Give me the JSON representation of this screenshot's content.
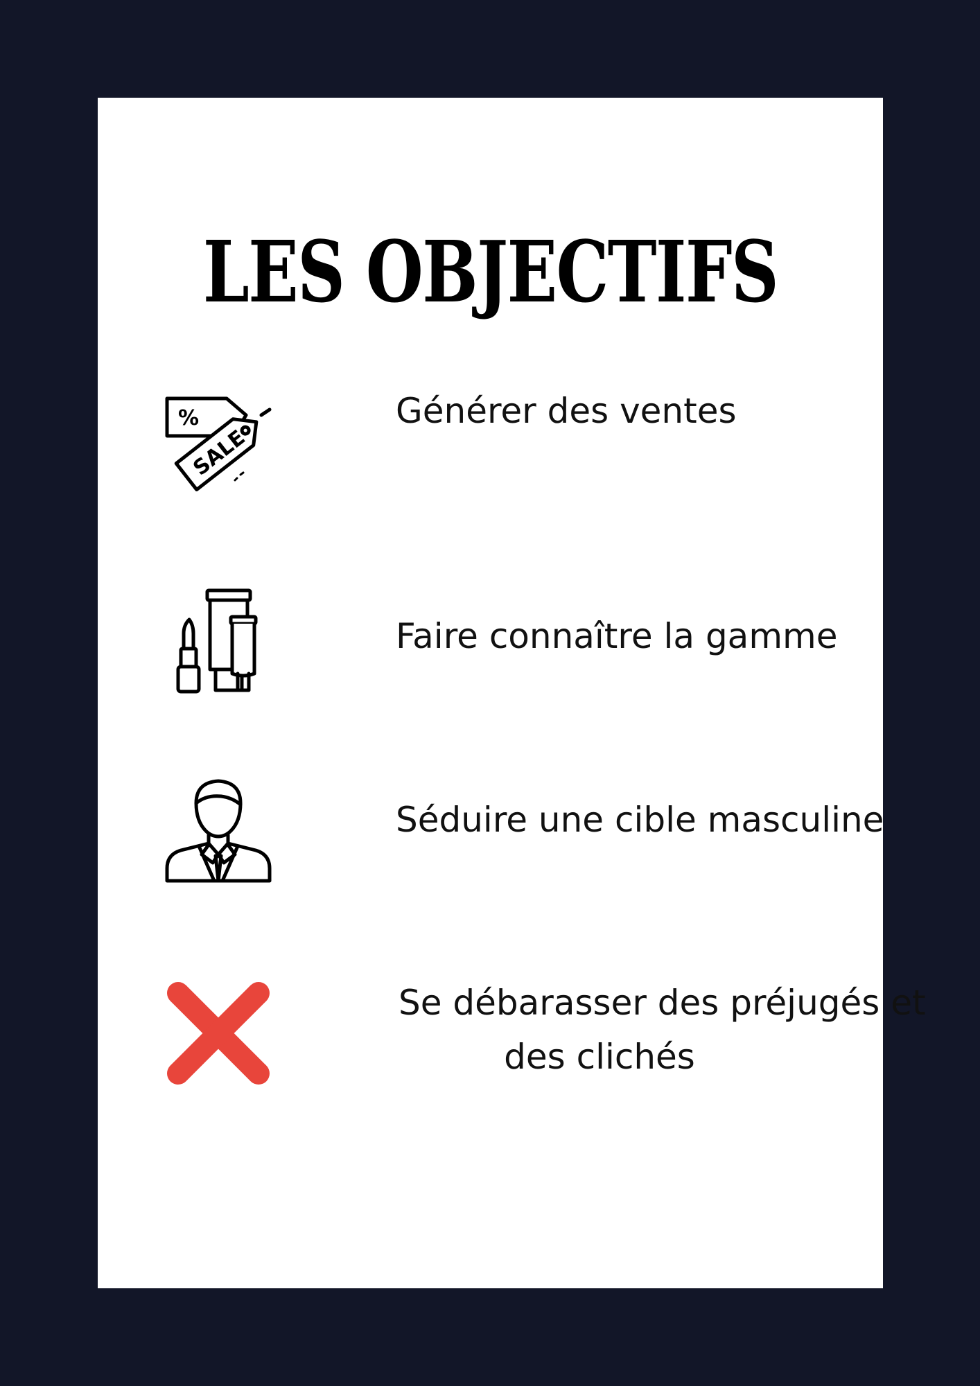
{
  "title": "LES OBJECTIFS",
  "objectives": [
    {
      "label": "Générer des ventes",
      "icon": "sale-tag-icon"
    },
    {
      "label": "Faire connaître la gamme",
      "icon": "cosmetics-icon"
    },
    {
      "label": "Séduire une cible masculine",
      "icon": "businessman-icon"
    },
    {
      "label_line1": "Se débarasser des préjugés et",
      "label_line2": "des clichés",
      "icon": "cross-icon"
    }
  ],
  "colors": {
    "background": "#121628",
    "card": "#ffffff",
    "cross": "#e8453b"
  }
}
